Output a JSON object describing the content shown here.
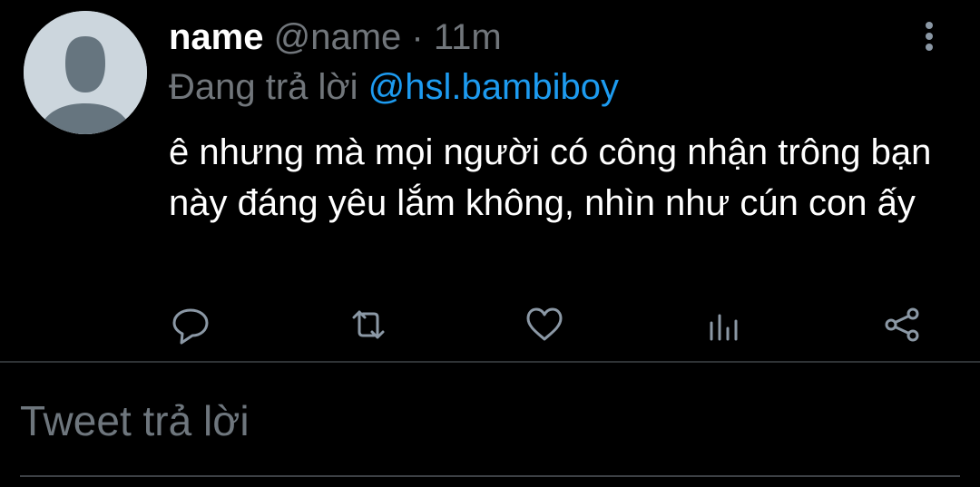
{
  "tweet": {
    "author_name": "name",
    "author_handle": "@name",
    "separator": "·",
    "time": "11m",
    "replying_to_label": "Đang trả lời",
    "replying_to_handle": "@hsl.bambiboy",
    "text": "ê nhưng mà mọi người có công nhận trông bạn này đáng yêu lắm không, nhìn như cún con ấy"
  },
  "actions": [
    {
      "icon": "reply-icon"
    },
    {
      "icon": "retweet-icon"
    },
    {
      "icon": "like-icon"
    },
    {
      "icon": "analytics-icon"
    },
    {
      "icon": "share-icon"
    }
  ],
  "reply_box": {
    "placeholder": "Tweet trả lời",
    "value": ""
  },
  "colors": {
    "background": "#000000",
    "text": "#ffffff",
    "muted": "#71767b",
    "link": "#1d9bf0",
    "icon": "#8b98a5",
    "divider": "#2f3336"
  }
}
